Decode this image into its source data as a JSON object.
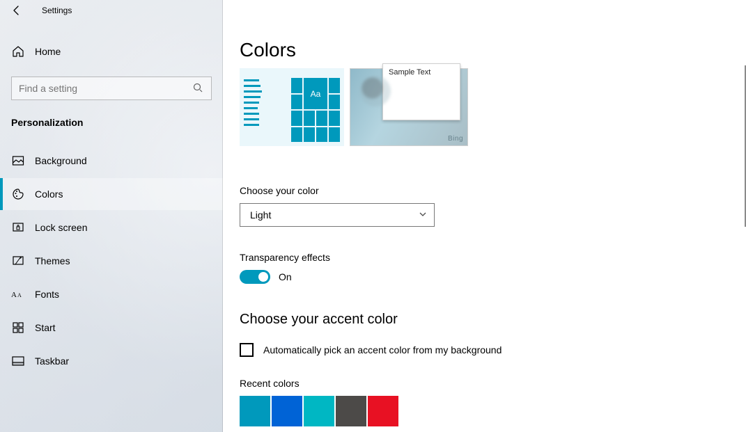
{
  "window": {
    "title": "Settings"
  },
  "sidebar": {
    "home": "Home",
    "search_placeholder": "Find a setting",
    "section": "Personalization",
    "items": [
      {
        "label": "Background",
        "icon": "background"
      },
      {
        "label": "Colors",
        "icon": "palette",
        "selected": true
      },
      {
        "label": "Lock screen",
        "icon": "lock-screen"
      },
      {
        "label": "Themes",
        "icon": "themes"
      },
      {
        "label": "Fonts",
        "icon": "fonts"
      },
      {
        "label": "Start",
        "icon": "start"
      },
      {
        "label": "Taskbar",
        "icon": "taskbar"
      }
    ]
  },
  "page": {
    "title": "Colors",
    "preview_sample": "Sample Text",
    "preview_tile_text": "Aa",
    "preview_brand": "Bing",
    "choose_color_label": "Choose your color",
    "choose_color_value": "Light",
    "transparency_label": "Transparency effects",
    "transparency_state": "On",
    "accent_heading": "Choose your accent color",
    "auto_accent_label": "Automatically pick an accent color from my background",
    "recent_label": "Recent colors",
    "recent_colors": [
      "#0099bc",
      "#0063d6",
      "#00b7c3",
      "#4c4a48",
      "#e81123"
    ]
  }
}
